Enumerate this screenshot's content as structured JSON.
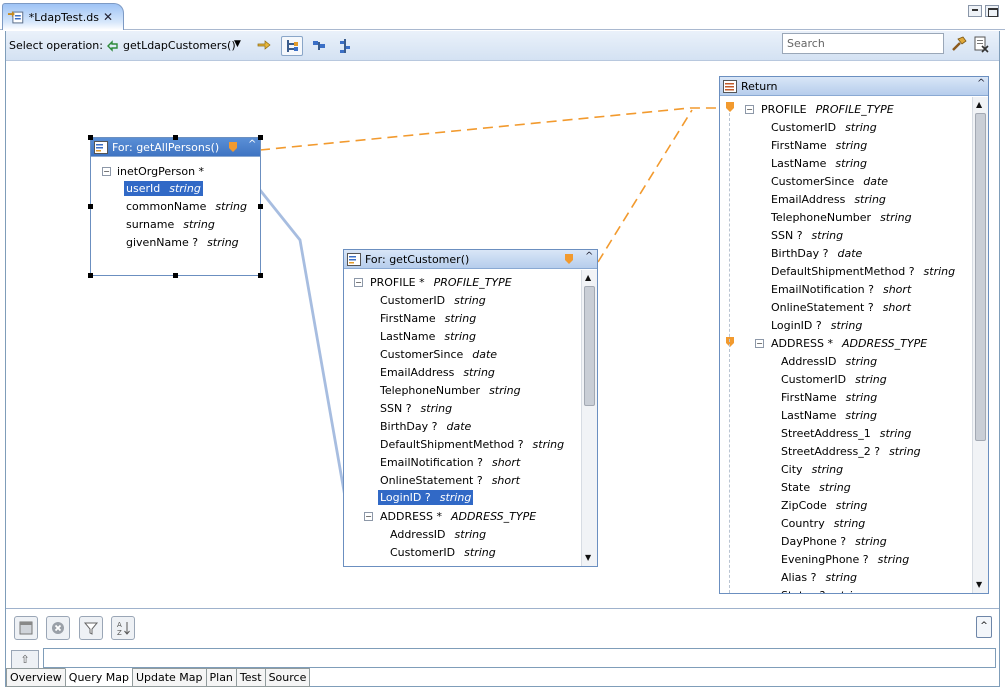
{
  "editor": {
    "tab_label": "*LdapTest.ds"
  },
  "toolbar": {
    "select_label": "Select operation:",
    "operation": "getLdapCustomers()",
    "search_placeholder": "Search"
  },
  "panels": {
    "persons": {
      "title": "For: getAllPersons()",
      "root": "inetOrgPerson *",
      "fields": [
        {
          "name": "userId",
          "type": "string",
          "selected": true
        },
        {
          "name": "commonName",
          "type": "string"
        },
        {
          "name": "surname",
          "type": "string"
        },
        {
          "name": "givenName ?",
          "type": "string"
        }
      ]
    },
    "customer": {
      "title": "For: getCustomer()",
      "root_name": "PROFILE *",
      "root_type": "PROFILE_TYPE",
      "fields": [
        {
          "name": "CustomerID",
          "type": "string"
        },
        {
          "name": "FirstName",
          "type": "string"
        },
        {
          "name": "LastName",
          "type": "string"
        },
        {
          "name": "CustomerSince",
          "type": "date"
        },
        {
          "name": "EmailAddress",
          "type": "string"
        },
        {
          "name": "TelephoneNumber",
          "type": "string"
        },
        {
          "name": "SSN ?",
          "type": "string"
        },
        {
          "name": "BirthDay ?",
          "type": "date"
        },
        {
          "name": "DefaultShipmentMethod ?",
          "type": "string"
        },
        {
          "name": "EmailNotification ?",
          "type": "short"
        },
        {
          "name": "OnlineStatement ?",
          "type": "short"
        },
        {
          "name": "LoginID ?",
          "type": "string",
          "selected": true
        }
      ],
      "sub_name": "ADDRESS *",
      "sub_type": "ADDRESS_TYPE",
      "sub_fields": [
        {
          "name": "AddressID",
          "type": "string"
        },
        {
          "name": "CustomerID",
          "type": "string"
        }
      ]
    },
    "return": {
      "title": "Return",
      "root_name": "PROFILE",
      "root_type": "PROFILE_TYPE",
      "fields": [
        {
          "name": "CustomerID",
          "type": "string"
        },
        {
          "name": "FirstName",
          "type": "string"
        },
        {
          "name": "LastName",
          "type": "string"
        },
        {
          "name": "CustomerSince",
          "type": "date"
        },
        {
          "name": "EmailAddress",
          "type": "string"
        },
        {
          "name": "TelephoneNumber",
          "type": "string"
        },
        {
          "name": "SSN ?",
          "type": "string"
        },
        {
          "name": "BirthDay ?",
          "type": "date"
        },
        {
          "name": "DefaultShipmentMethod ?",
          "type": "string"
        },
        {
          "name": "EmailNotification ?",
          "type": "short"
        },
        {
          "name": "OnlineStatement ?",
          "type": "short"
        },
        {
          "name": "LoginID ?",
          "type": "string"
        }
      ],
      "sub_name": "ADDRESS *",
      "sub_type": "ADDRESS_TYPE",
      "sub_fields": [
        {
          "name": "AddressID",
          "type": "string"
        },
        {
          "name": "CustomerID",
          "type": "string"
        },
        {
          "name": "FirstName",
          "type": "string"
        },
        {
          "name": "LastName",
          "type": "string"
        },
        {
          "name": "StreetAddress_1",
          "type": "string"
        },
        {
          "name": "StreetAddress_2 ?",
          "type": "string"
        },
        {
          "name": "City",
          "type": "string"
        },
        {
          "name": "State",
          "type": "string"
        },
        {
          "name": "ZipCode",
          "type": "string"
        },
        {
          "name": "Country",
          "type": "string"
        },
        {
          "name": "DayPhone ?",
          "type": "string"
        },
        {
          "name": "EveningPhone ?",
          "type": "string"
        },
        {
          "name": "Alias ?",
          "type": "string"
        },
        {
          "name": "Status ?",
          "type": "string"
        }
      ]
    }
  },
  "bottom_tabs": [
    "Overview",
    "Query Map",
    "Update Map",
    "Plan",
    "Test",
    "Source"
  ],
  "active_tab": "Query Map",
  "colors": {
    "selection": "#3169c6",
    "panel_border": "#6b8fc0",
    "link_dashed": "#f29a2e",
    "link_solid": "#a7bde0"
  }
}
